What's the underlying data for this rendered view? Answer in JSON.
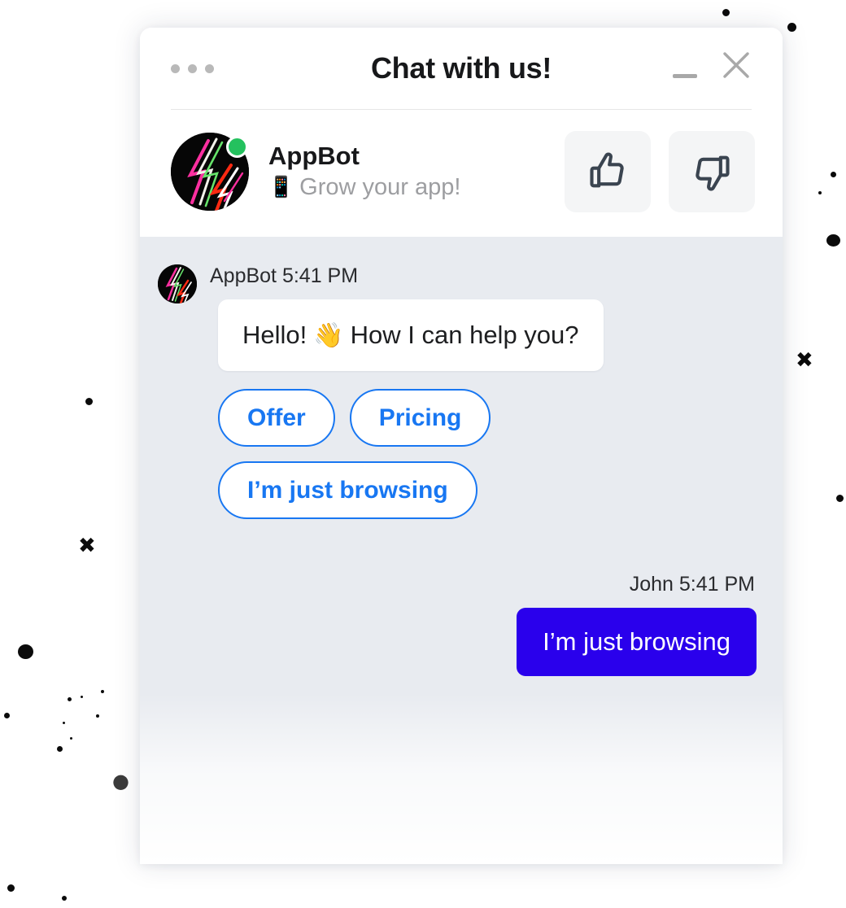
{
  "window": {
    "title": "Chat with us!",
    "menu_icon": "kebab-menu-icon",
    "minimize_icon": "minimize-icon",
    "close_icon": "close-icon"
  },
  "profile": {
    "name": "AppBot",
    "tagline_emoji": "📱",
    "tagline": "Grow your app!",
    "status": "online",
    "status_color": "#24c15e",
    "thumbs_up_icon": "thumbs-up-icon",
    "thumbs_down_icon": "thumbs-down-icon"
  },
  "conversation": {
    "bot_message": {
      "author": "AppBot",
      "time": "5:41 PM",
      "meta": "AppBot 5:41 PM",
      "text_before": "Hello!",
      "emoji": "👋",
      "text_after": "How I can help you?"
    },
    "quick_replies": [
      {
        "label": "Offer"
      },
      {
        "label": "Pricing"
      },
      {
        "label": "I’m just browsing"
      }
    ],
    "user_message": {
      "author": "John",
      "time": "5:41 PM",
      "meta": "John 5:41 PM",
      "text": "I’m just browsing"
    }
  },
  "colors": {
    "accent_blue": "#1877f2",
    "user_bubble": "#2a00ec",
    "chat_background": "#e8ebf0",
    "panel_background": "#ffffff",
    "muted_text": "#9d9ea1"
  }
}
